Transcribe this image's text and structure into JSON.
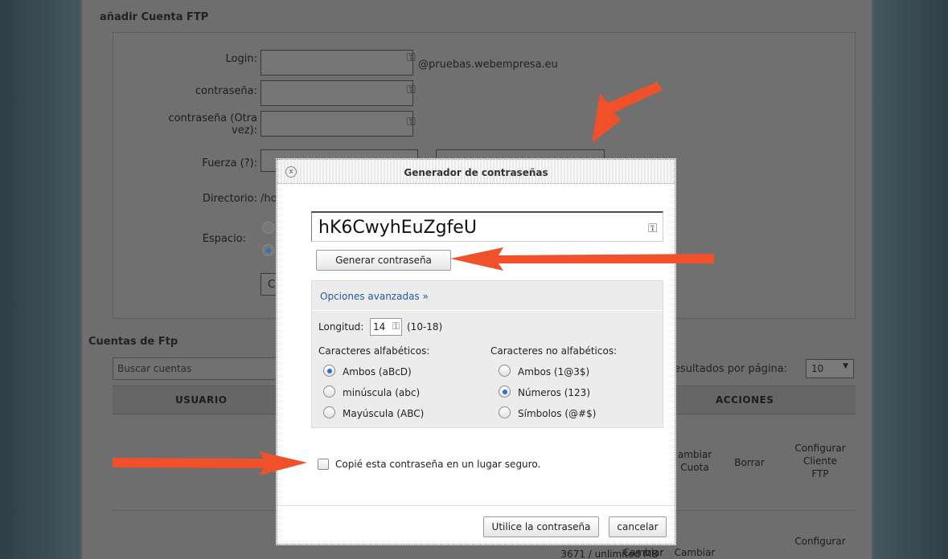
{
  "form": {
    "title": "añadir Cuenta FTP",
    "login_label": "Login:",
    "password_label": "contraseña:",
    "password_again_label_1": "contraseña (Otra",
    "password_again_label_2": "vez):",
    "domain": "@pruebas.webempresa.eu",
    "strength_label": "Fuerza (?):",
    "directory_label": "Directorio:",
    "directory_value": "/ho",
    "space_label": "Espacio:",
    "partial_button": "C"
  },
  "accounts": {
    "title": "Cuentas de Ftp",
    "search_placeholder": "Buscar cuentas",
    "per_page_label": "esultados por página:",
    "per_page_value": "10",
    "col_user": "Usuario",
    "col_actions": "Acciones",
    "row1_quota": "ambiar\nCuota",
    "row1_delete": "Borrar",
    "row1_configure": "Configurar\nCliente\nFTP",
    "row2_usage": "3671 / unlimited MB",
    "row2_change1": "Cambiar",
    "row2_change2": "Cambiar",
    "row2_configure": "Configurar"
  },
  "modal": {
    "title": "Generador de contraseñas",
    "close": "x",
    "password": "hK6CwyhEuZgfeU",
    "generate_button": "Generar contraseña",
    "advanced_link": "Opciones avanzadas »",
    "length_label": "Longitud:",
    "length_value": "14",
    "length_range": "(10-18)",
    "alpha_title": "Caracteres alfabéticos:",
    "alpha_options": [
      "Ambos (aBcD)",
      "minúscula (abc)",
      "Mayúscula (ABC)"
    ],
    "nonalpha_title": "Caracteres no alfabéticos:",
    "nonalpha_options": [
      "Ambos (1@3$)",
      "Números (123)",
      "Símbolos (@#$)"
    ],
    "alpha_selected": 0,
    "nonalpha_selected": 1,
    "copied_label": "Copié esta contraseña en un lugar seguro.",
    "use_button": "Utilice la contraseña",
    "cancel_button": "cancelar"
  },
  "colors": {
    "arrow": "#f0502a",
    "link": "#2159a8",
    "radio_selected": "#2d6fd0"
  },
  "icons": [
    "key-icon",
    "close-icon",
    "radio-icon",
    "checkbox-icon",
    "arrow-annotation"
  ]
}
